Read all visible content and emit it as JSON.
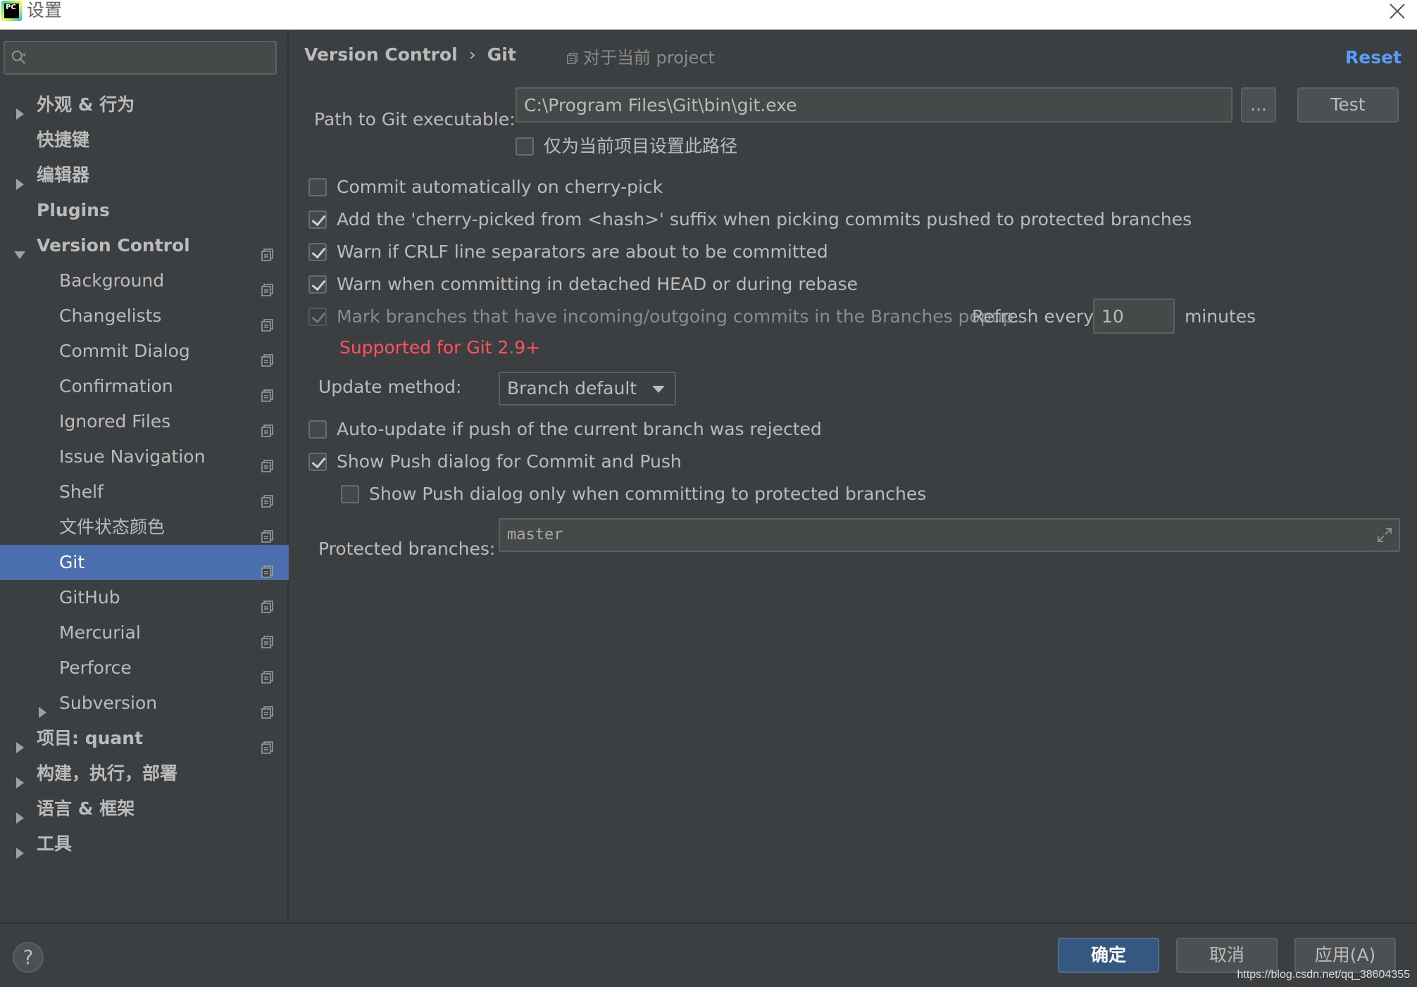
{
  "window": {
    "title": "设置",
    "app_icon_text": "PC"
  },
  "sidebar": {
    "search_placeholder": "",
    "items": [
      {
        "label": "外观 & 行为",
        "bold": true,
        "expander": "collapsed",
        "indent": 0,
        "copy": false
      },
      {
        "label": "快捷键",
        "bold": true,
        "expander": "none",
        "indent": 0,
        "copy": false
      },
      {
        "label": "编辑器",
        "bold": true,
        "expander": "collapsed",
        "indent": 0,
        "copy": false
      },
      {
        "label": "Plugins",
        "bold": true,
        "expander": "none",
        "indent": 0,
        "copy": false
      },
      {
        "label": "Version Control",
        "bold": true,
        "expander": "expanded",
        "indent": 0,
        "copy": true
      },
      {
        "label": "Background",
        "bold": false,
        "expander": "none",
        "indent": 1,
        "copy": true
      },
      {
        "label": "Changelists",
        "bold": false,
        "expander": "none",
        "indent": 1,
        "copy": true
      },
      {
        "label": "Commit Dialog",
        "bold": false,
        "expander": "none",
        "indent": 1,
        "copy": true
      },
      {
        "label": "Confirmation",
        "bold": false,
        "expander": "none",
        "indent": 1,
        "copy": true
      },
      {
        "label": "Ignored Files",
        "bold": false,
        "expander": "none",
        "indent": 1,
        "copy": true
      },
      {
        "label": "Issue Navigation",
        "bold": false,
        "expander": "none",
        "indent": 1,
        "copy": true
      },
      {
        "label": "Shelf",
        "bold": false,
        "expander": "none",
        "indent": 1,
        "copy": true
      },
      {
        "label": "文件状态颜色",
        "bold": false,
        "expander": "none",
        "indent": 1,
        "copy": true
      },
      {
        "label": "Git",
        "bold": false,
        "expander": "none",
        "indent": 1,
        "copy": true,
        "selected": true
      },
      {
        "label": "GitHub",
        "bold": false,
        "expander": "none",
        "indent": 1,
        "copy": true
      },
      {
        "label": "Mercurial",
        "bold": false,
        "expander": "none",
        "indent": 1,
        "copy": true
      },
      {
        "label": "Perforce",
        "bold": false,
        "expander": "none",
        "indent": 1,
        "copy": true
      },
      {
        "label": "Subversion",
        "bold": false,
        "expander": "collapsed",
        "indent": 1,
        "copy": true
      },
      {
        "label": "项目: quant",
        "bold": true,
        "expander": "collapsed",
        "indent": 0,
        "copy": true
      },
      {
        "label": "构建，执行，部署",
        "bold": true,
        "expander": "collapsed",
        "indent": 0,
        "copy": false
      },
      {
        "label": "语言 & 框架",
        "bold": true,
        "expander": "collapsed",
        "indent": 0,
        "copy": false
      },
      {
        "label": "工具",
        "bold": true,
        "expander": "collapsed",
        "indent": 0,
        "copy": false
      }
    ]
  },
  "header": {
    "breadcrumb_parent": "Version Control",
    "breadcrumb_separator": "›",
    "breadcrumb_current": "Git",
    "scope_label": "对于当前 project",
    "reset_label": "Reset"
  },
  "git": {
    "path_label": "Path to Git executable:",
    "path_value": "C:\\Program Files\\Git\\bin\\git.exe",
    "browse_label": "...",
    "test_label": "Test",
    "project_only_label": "仅为当前项目设置此路径",
    "project_only_checked": false,
    "options": [
      {
        "label": "Commit automatically on cherry-pick",
        "checked": false,
        "disabled": false
      },
      {
        "label": "Add the 'cherry-picked from <hash>' suffix when picking commits pushed to protected branches",
        "checked": true,
        "disabled": false
      },
      {
        "label": "Warn if CRLF line separators are about to be committed",
        "checked": true,
        "disabled": false
      },
      {
        "label": "Warn when committing in detached HEAD or during rebase",
        "checked": true,
        "disabled": false
      }
    ],
    "mark_branches_label": "Mark branches that have incoming/outgoing commits in the Branches popup.",
    "mark_branches_checked": true,
    "refresh_every_label": "Refresh every",
    "refresh_value": "10",
    "minutes_label": "minutes",
    "supported_note": "Supported for Git 2.9+",
    "update_method_label": "Update method:",
    "update_method_value": "Branch default",
    "auto_update_label": "Auto-update if push of the current branch was rejected",
    "auto_update_checked": false,
    "show_push_label": "Show Push dialog for Commit and Push",
    "show_push_checked": true,
    "show_push_protected_label": "Show Push dialog only when committing to protected branches",
    "show_push_protected_checked": false,
    "protected_branches_label": "Protected branches:",
    "protected_branches_value": "master"
  },
  "footer": {
    "help_label": "?",
    "ok_label": "确定",
    "cancel_label": "取消",
    "apply_label": "应用(A)",
    "watermark": "https://blog.csdn.net/qq_38604355"
  },
  "colors": {
    "background": "#3c3f41",
    "selection": "#4b6eaf",
    "link": "#589df6",
    "error": "#ff5261",
    "primary_button": "#365880"
  }
}
